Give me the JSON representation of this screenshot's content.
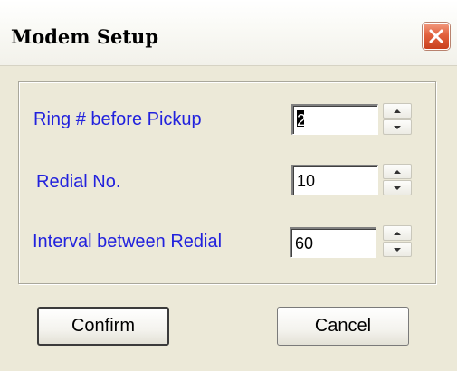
{
  "dialog": {
    "title": "Modem Setup",
    "close_icon": "close-x-icon"
  },
  "fields": [
    {
      "label": "Ring # before Pickup",
      "value": "2"
    },
    {
      "label": "Redial No.",
      "value": "10"
    },
    {
      "label": "Interval between Redial",
      "value": "60"
    }
  ],
  "buttons": {
    "confirm_label": "Confirm",
    "cancel_label": "Cancel"
  },
  "colors": {
    "label_text": "#2222dd",
    "close_button": "#e2613d",
    "dialog_background": "#ece9d8"
  }
}
